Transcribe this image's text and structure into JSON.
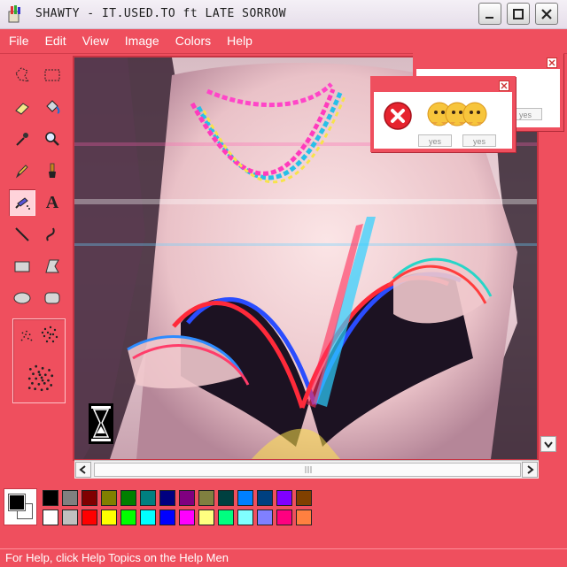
{
  "window": {
    "title": "SHAWTY - IT.USED.TO ft LATE SORROW",
    "app_icon": "paint-app-icon",
    "controls": [
      "minimize-icon",
      "maximize-icon",
      "close-icon"
    ]
  },
  "menubar": {
    "items": [
      {
        "label": "File"
      },
      {
        "label": "Edit"
      },
      {
        "label": "View"
      },
      {
        "label": "Image"
      },
      {
        "label": "Colors"
      },
      {
        "label": "Help"
      }
    ]
  },
  "tools": [
    {
      "name": "free-form-select-icon"
    },
    {
      "name": "rect-select-icon"
    },
    {
      "name": "eraser-icon"
    },
    {
      "name": "fill-bucket-icon"
    },
    {
      "name": "color-picker-icon"
    },
    {
      "name": "magnifier-icon"
    },
    {
      "name": "pencil-icon"
    },
    {
      "name": "brush-icon"
    },
    {
      "name": "airbrush-icon",
      "selected": true
    },
    {
      "name": "text-icon",
      "glyph": "A"
    },
    {
      "name": "line-icon"
    },
    {
      "name": "curve-icon"
    },
    {
      "name": "rectangle-icon"
    },
    {
      "name": "polygon-icon"
    },
    {
      "name": "ellipse-icon"
    },
    {
      "name": "rounded-rectangle-icon"
    }
  ],
  "tool_options": [
    "spray-small-icon",
    "spray-medium-icon",
    "spray-large-icon"
  ],
  "canvas": {
    "content": "glitch-photo",
    "cursor": "hourglass-icon"
  },
  "popups": [
    {
      "id": "back",
      "button": "yes"
    },
    {
      "id": "front",
      "icon": "error-icon",
      "emoji": "pleading-face-hands-emoji",
      "buttons": [
        "yes",
        "yes"
      ]
    }
  ],
  "palette": {
    "primary": "#000000",
    "secondary": "#ffffff",
    "row1": [
      "#000000",
      "#808080",
      "#800000",
      "#808000",
      "#008000",
      "#008080",
      "#000080",
      "#800080",
      "#808040",
      "#004040",
      "#0080ff",
      "#004080",
      "#8000ff",
      "#804000"
    ],
    "row2": [
      "#ffffff",
      "#c0c0c0",
      "#ff0000",
      "#ffff00",
      "#00ff00",
      "#00ffff",
      "#0000ff",
      "#ff00ff",
      "#ffff80",
      "#00ff80",
      "#80ffff",
      "#8080ff",
      "#ff0080",
      "#ff8040"
    ]
  },
  "statusbar": {
    "text": "For Help, click Help Topics on the Help Men"
  },
  "colors": {
    "accent": "#ef4f5e",
    "titlebar": "#f0eaf2"
  }
}
